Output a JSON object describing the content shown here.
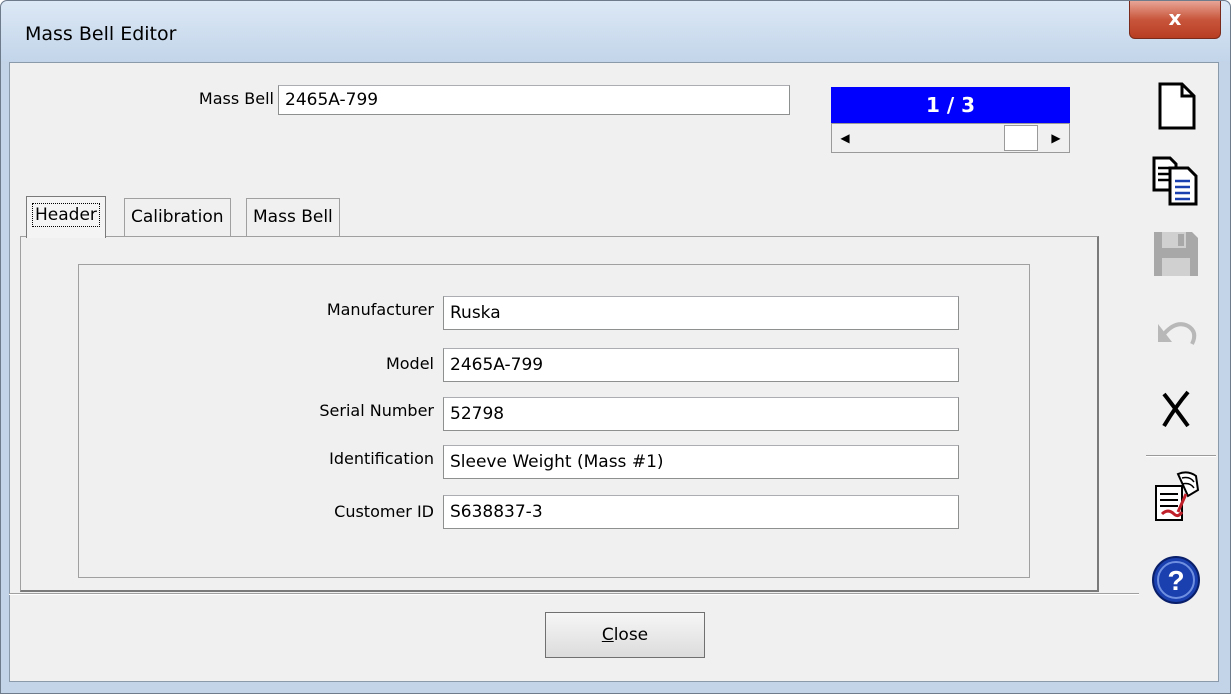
{
  "window": {
    "title": "Mass Bell Editor",
    "close_glyph": "x"
  },
  "record": {
    "label": "Mass Bell",
    "value": "2465A-799",
    "counter": "1 / 3"
  },
  "tabs": [
    {
      "label": "Header",
      "active": true
    },
    {
      "label": "Calibration",
      "active": false
    },
    {
      "label": "Mass Bell",
      "active": false
    }
  ],
  "header_form": {
    "fields": [
      {
        "label": "Manufacturer",
        "value": "Ruska"
      },
      {
        "label": "Model",
        "value": "2465A-799"
      },
      {
        "label": "Serial Number",
        "value": "52798"
      },
      {
        "label": "Identification",
        "value": "Sleeve Weight (Mass #1)"
      },
      {
        "label": "Customer ID",
        "value": "S638837-3"
      }
    ]
  },
  "footer": {
    "close_label_underlined": "C",
    "close_label_rest": "lose"
  },
  "toolbar": {
    "icons": [
      "new-document-icon",
      "copy-icon",
      "save-icon",
      "undo-icon",
      "delete-icon",
      "sign-document-icon",
      "help-icon"
    ]
  },
  "colors": {
    "counter_bg": "#0000ff",
    "title_close_red": "#c8563c",
    "help_blue": "#1a3fae"
  }
}
